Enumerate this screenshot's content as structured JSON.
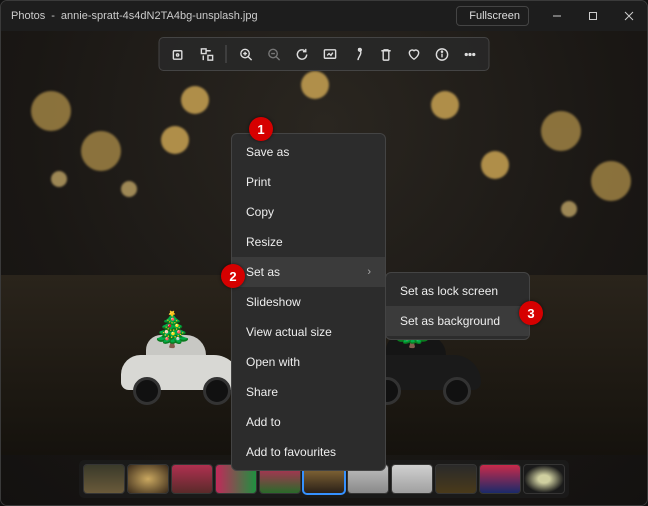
{
  "titlebar": {
    "app": "Photos",
    "filename": "annie-spratt-4s4dN2TA4bg-unsplash.jpg",
    "fullscreen": "Fullscreen"
  },
  "context_menu": {
    "save_as": "Save as",
    "print": "Print",
    "copy": "Copy",
    "resize": "Resize",
    "set_as": "Set as",
    "slideshow": "Slideshow",
    "view_actual_size": "View actual size",
    "open_with": "Open with",
    "share": "Share",
    "add_to": "Add to",
    "add_to_favourites": "Add to favourites"
  },
  "submenu": {
    "set_as_lock_screen": "Set as lock screen",
    "set_as_background": "Set as background"
  },
  "badges": {
    "one": "1",
    "two": "2",
    "three": "3"
  },
  "thumbs": [
    {
      "g": "linear-gradient(#3a3a2a,#6a5a3a)"
    },
    {
      "g": "radial-gradient(#caa860,#3a2a1a)"
    },
    {
      "g": "linear-gradient(#b03050,#5a2a2a)"
    },
    {
      "g": "linear-gradient(90deg,#c02a5a,#209040)"
    },
    {
      "g": "linear-gradient(#c02a5a,#2a6a2a)"
    },
    {
      "g": "linear-gradient(#90703a,#2a2018)"
    },
    {
      "g": "linear-gradient(#bfbfbf,#8a8a8a)"
    },
    {
      "g": "linear-gradient(#d0d0d0,#a0a0a0)"
    },
    {
      "g": "linear-gradient(#2a2a2a,#4a3a1a)"
    },
    {
      "g": "linear-gradient(#c82a4a,#1a2a6a)"
    },
    {
      "g": "radial-gradient(#cfcfa0 20%,#1a1a1a 70%)"
    }
  ]
}
